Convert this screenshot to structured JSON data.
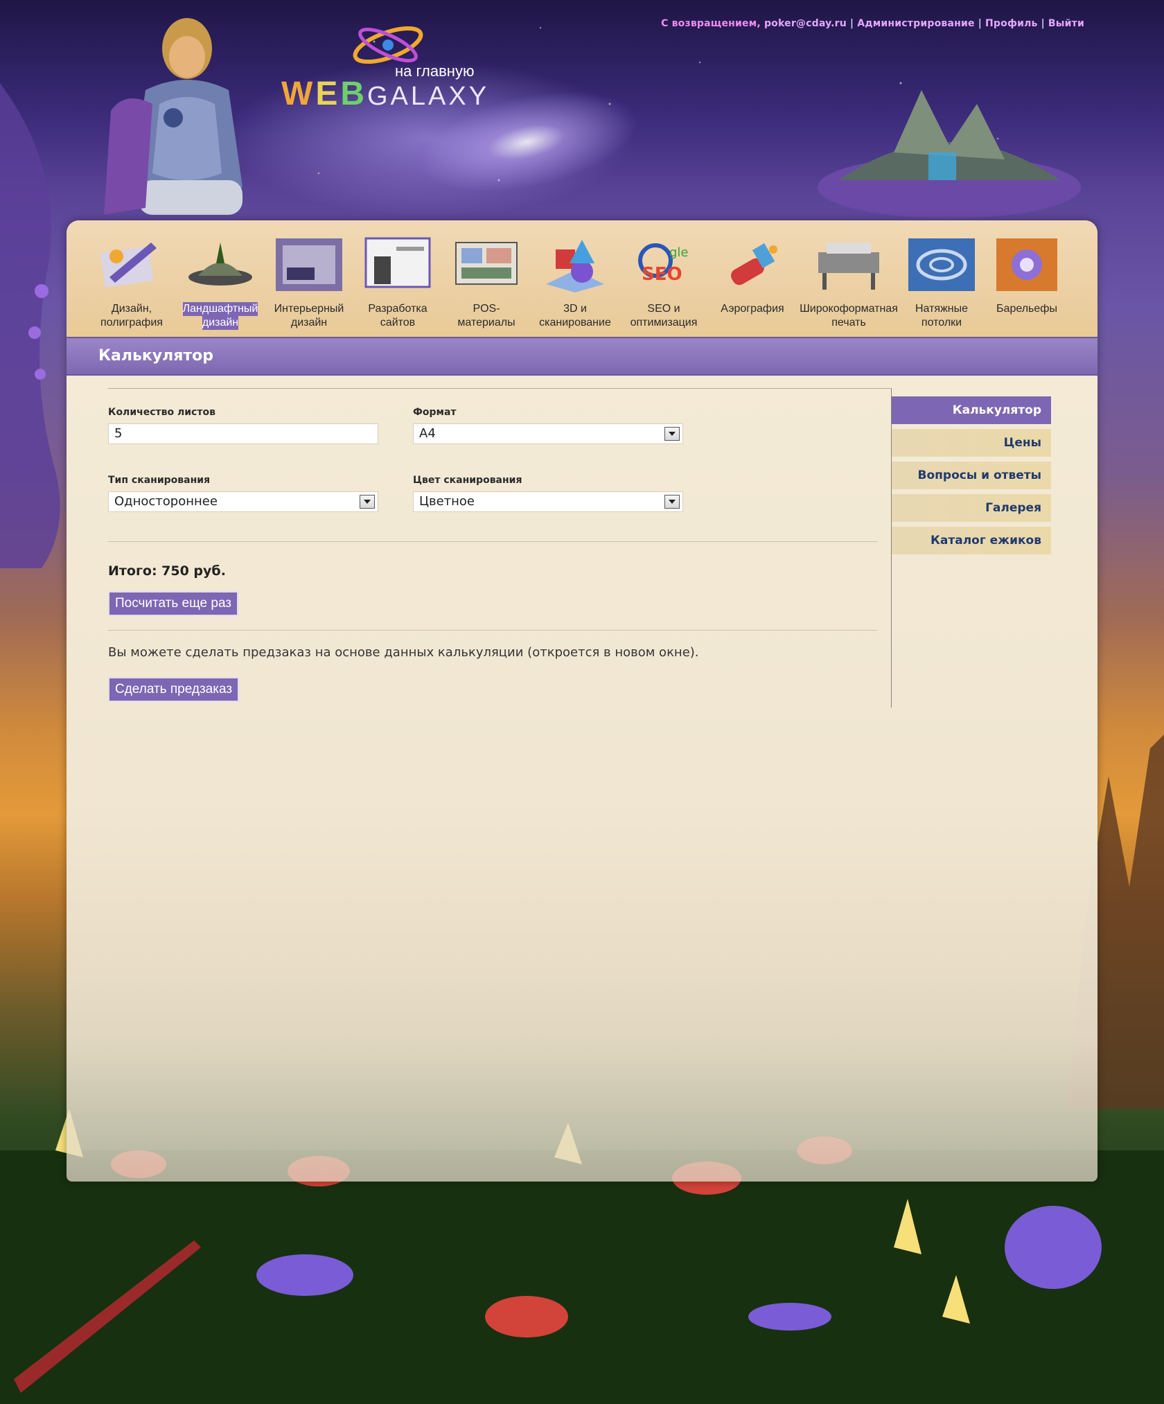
{
  "colors": {
    "accent": "#7d66b3",
    "nav_bg": "#e9ca98",
    "panel_bg": "#f0e6d2",
    "link": "#1f3a6e"
  },
  "header": {
    "greeting_prefix": "С возвращением, ",
    "user_email": "poker@cday.ru",
    "links": [
      "Администрирование",
      "Профиль",
      "Выйти"
    ],
    "logo_home": "на главную",
    "logo_brand_1": "W",
    "logo_brand_2": "E",
    "logo_brand_3": "B",
    "logo_brand_4": "GALAXY"
  },
  "nav": {
    "items": [
      {
        "label_1": "Дизайн,",
        "label_2": "полиграфия",
        "icon": "design-icon"
      },
      {
        "label_1": "Ландшафтный",
        "label_2": "дизайн",
        "icon": "landscape-icon",
        "active": true
      },
      {
        "label_1": "Интерьерный",
        "label_2": "дизайн",
        "icon": "interior-icon"
      },
      {
        "label_1": "Разработка",
        "label_2": "сайтов",
        "icon": "website-icon"
      },
      {
        "label_1": "POS-",
        "label_2": "материалы",
        "icon": "pos-icon"
      },
      {
        "label_1": "3D и",
        "label_2": "сканирование",
        "icon": "3d-icon"
      },
      {
        "label_1": "SEO и",
        "label_2": "оптимизация",
        "icon": "seo-icon"
      },
      {
        "label_1": "Аэрография",
        "label_2": "",
        "icon": "airbrush-icon"
      },
      {
        "label_1": "Широкоформатная",
        "label_2": "печать",
        "icon": "printer-icon"
      },
      {
        "label_1": "Натяжные",
        "label_2": "потолки",
        "icon": "ceiling-icon"
      },
      {
        "label_1": "Барельефы",
        "label_2": "",
        "icon": "bas-relief-icon"
      }
    ]
  },
  "page": {
    "title": "Калькулятор"
  },
  "form": {
    "sheets_label": "Количество листов",
    "sheets_value": "5",
    "format_label": "Формат",
    "format_value": "A4",
    "scan_type_label": "Тип сканирования",
    "scan_type_value": "Одностороннее",
    "scan_color_label": "Цвет сканирования",
    "scan_color_value": "Цветное",
    "total_text": "Итого: 750 руб.",
    "recalc_button": "Посчитать еще раз",
    "preorder_note": "Вы можете сделать предзаказ на основе данных калькуляции (откроется в новом окне).",
    "preorder_button": "Сделать предзаказ"
  },
  "sidebar": {
    "items": [
      {
        "label": "Калькулятор",
        "active": true
      },
      {
        "label": "Цены"
      },
      {
        "label": "Вопросы и ответы"
      },
      {
        "label": "Галерея"
      },
      {
        "label": "Каталог ежиков"
      }
    ]
  }
}
